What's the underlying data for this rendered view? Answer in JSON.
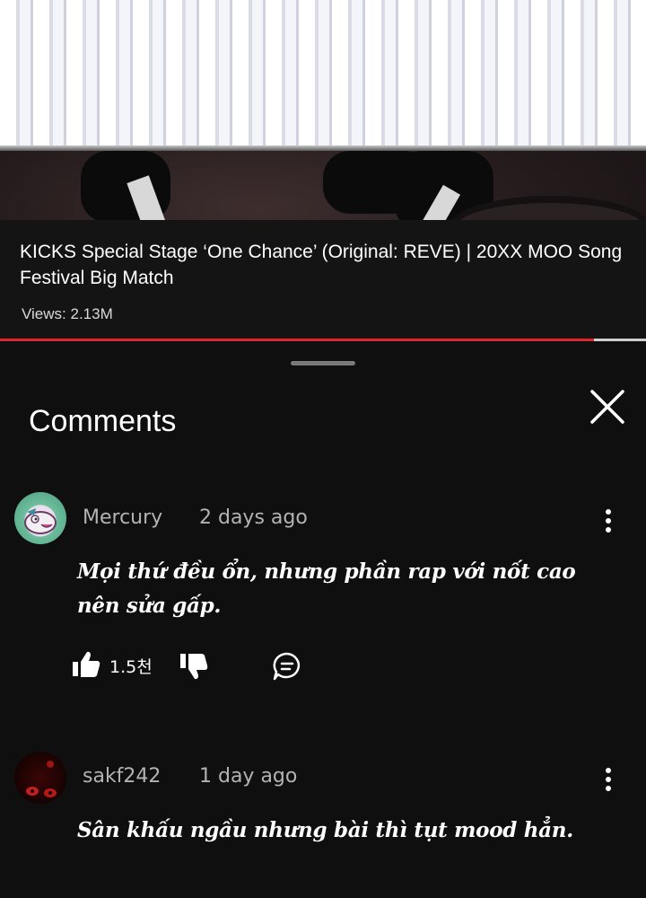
{
  "video": {
    "title": "KICKS Special Stage ‘One Chance’ (Original: REVE) | 20XX MOO Song Festival Big Match",
    "views": "Views: 2.13M",
    "progress": 0.92
  },
  "comments_panel": {
    "title": "Comments",
    "comments": [
      {
        "author": "Mercury",
        "time": "2 days ago",
        "text": "Mọi thứ đều ổn, nhưng phần rap với nốt cao nên sửa gấp.",
        "likes": "1.5천"
      },
      {
        "author": "sakf242",
        "time": "1 day ago",
        "text": "Sân khấu ngầu nhưng bài thì tụt mood hẳn."
      }
    ]
  },
  "colors": {
    "background": "#0f0f0f",
    "progress_red": "#e0262b",
    "secondary_text": "#b3b3b3"
  },
  "icons": [
    "close-icon",
    "more-vert-icon",
    "thumbs-up-icon",
    "thumbs-down-icon",
    "reply-icon"
  ]
}
